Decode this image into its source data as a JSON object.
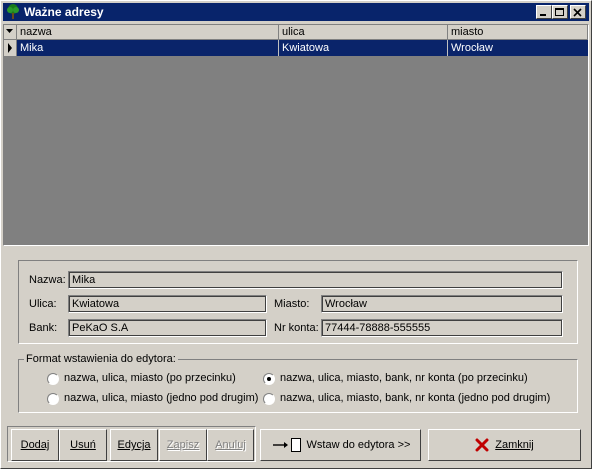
{
  "window": {
    "title": "Ważne adresy",
    "minimize_icon": "minimize-icon",
    "maximize_icon": "maximize-icon",
    "close_icon": "close-icon",
    "app_icon": "tree-icon"
  },
  "grid": {
    "columns": [
      "nazwa",
      "ulica",
      "miasto"
    ],
    "rows": [
      {
        "nazwa": "Mika",
        "ulica": "Kwiatowa",
        "miasto": "Wrocław",
        "selected": true
      }
    ]
  },
  "form": {
    "nazwa_label": "Nazwa:",
    "nazwa_value": "Mika",
    "ulica_label": "Ulica:",
    "ulica_value": "Kwiatowa",
    "miasto_label": "Miasto:",
    "miasto_value": "Wrocław",
    "bank_label": "Bank:",
    "bank_value": "PeKaO S.A",
    "nrkonta_label": "Nr konta:",
    "nrkonta_value": "77444-78888-555555"
  },
  "format": {
    "legend": "Format wstawienia do edytora:",
    "options": [
      {
        "label": "nazwa, ulica, miasto (po przecinku)",
        "checked": false
      },
      {
        "label": "nazwa, ulica, miasto, bank, nr konta (po przecinku)",
        "checked": true
      },
      {
        "label": "nazwa, ulica, miasto (jedno pod drugim)",
        "checked": false
      },
      {
        "label": "nazwa, ulica, miasto, bank, nr konta (jedno pod drugim)",
        "checked": false
      }
    ]
  },
  "buttons": {
    "dodaj": "Dodaj",
    "usun": "Usuń",
    "edycja": "Edycja",
    "zapisz": "Zapisz",
    "anuluj": "Anuluj",
    "wstaw": "Wstaw do edytora >>",
    "zamknij": "Zamknij"
  },
  "colors": {
    "title_bar": "#08246b",
    "selection": "#0a246a",
    "face": "#d4d0c8",
    "close_x": "#c00000"
  }
}
